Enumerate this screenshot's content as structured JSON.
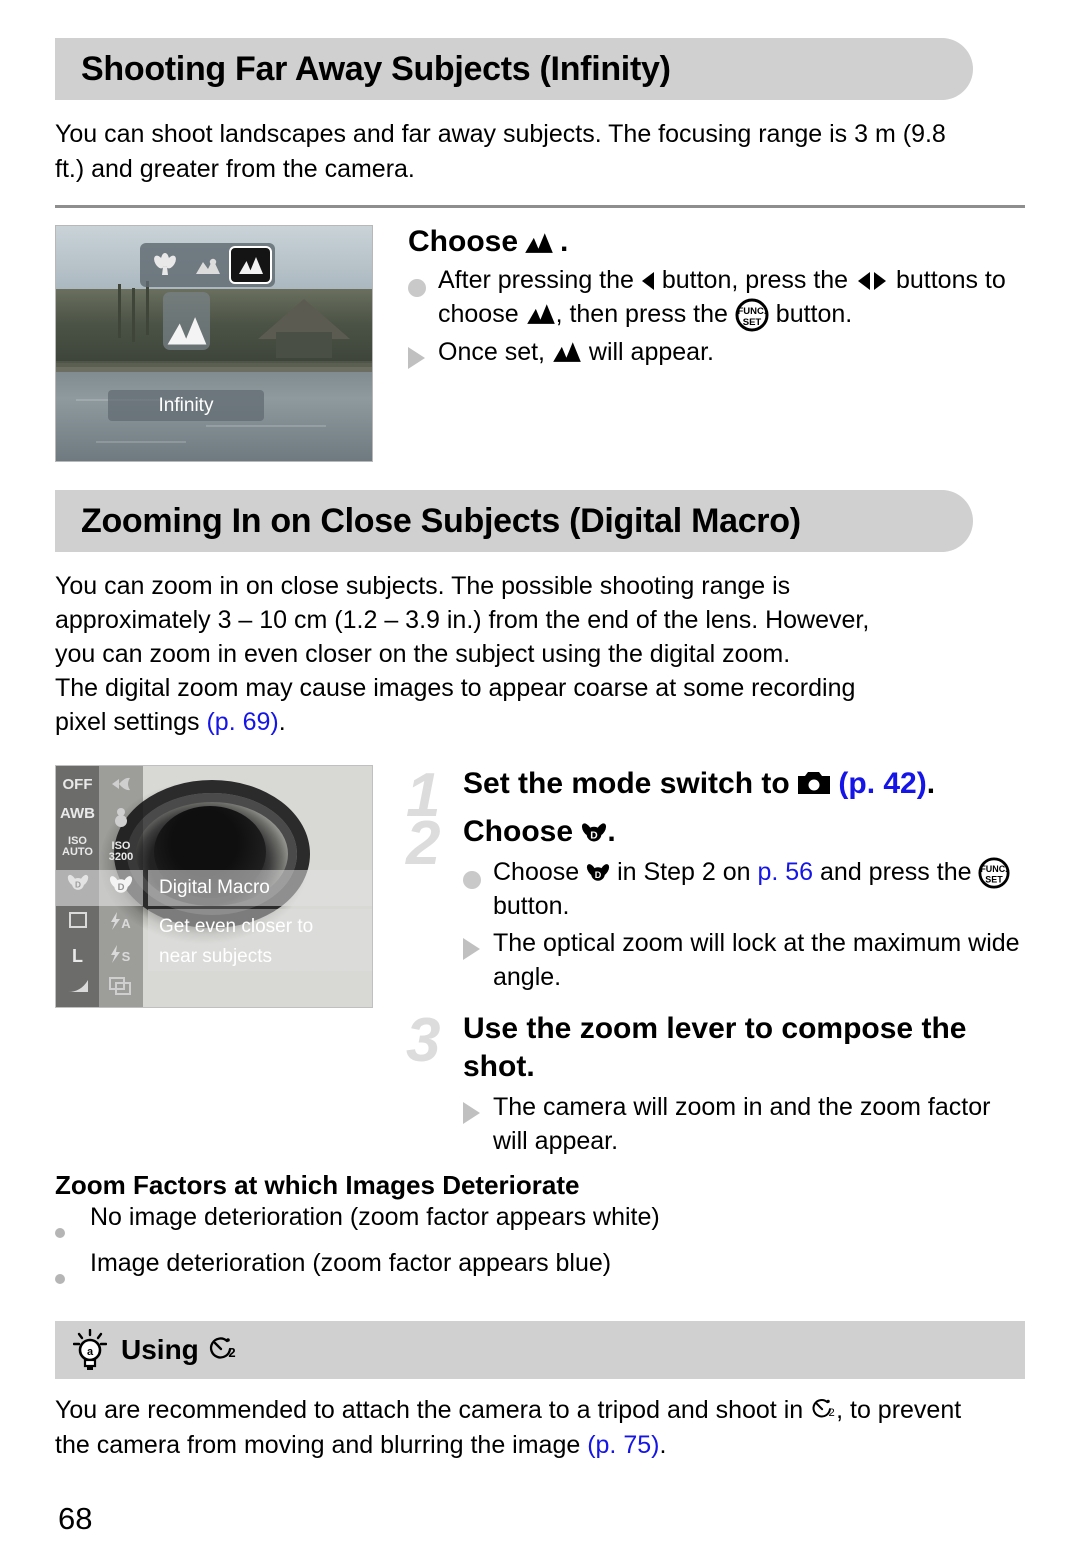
{
  "page": {
    "number": "68",
    "link_color": "#1515e8",
    "banner_color": "#d0d0d0"
  },
  "section1": {
    "title": "Shooting Far Away Subjects (Infinity)",
    "intro": "You can shoot landscapes and far away subjects. The focusing range is 3 m (9.8 ft.) and greater from the camera.",
    "screen": {
      "mode_icons": [
        "macro-flower-icon",
        "macro-mountain-icon",
        "infinity-mountain-icon"
      ],
      "selected_index": 2,
      "label": "Infinity"
    },
    "step": {
      "title_prefix": "Choose",
      "title_icon": "infinity-mountain-icon",
      "title_suffix": ".",
      "bullets": [
        {
          "marker": "dot",
          "parts": [
            {
              "t": "text",
              "v": "After pressing the "
            },
            {
              "t": "icon",
              "v": "left-arrow-button-icon"
            },
            {
              "t": "text",
              "v": " button, press the "
            },
            {
              "t": "icon",
              "v": "left-right-arrow-buttons-icon"
            },
            {
              "t": "text",
              "v": " buttons to choose "
            },
            {
              "t": "icon",
              "v": "infinity-mountain-icon"
            },
            {
              "t": "text",
              "v": ", then press the "
            },
            {
              "t": "icon",
              "v": "func-set-button-icon"
            },
            {
              "t": "text",
              "v": " button."
            }
          ]
        },
        {
          "marker": "triangle",
          "parts": [
            {
              "t": "text",
              "v": "Once set, "
            },
            {
              "t": "icon",
              "v": "infinity-mountain-icon"
            },
            {
              "t": "text",
              "v": " will appear."
            }
          ]
        }
      ]
    }
  },
  "section2": {
    "title": "Zooming In on Close Subjects (Digital Macro)",
    "intro_lines": [
      "You can zoom in on close subjects. The possible shooting range is",
      "approximately 3 – 10 cm (1.2 – 3.9 in.) from the end of the lens. However,",
      "you can zoom in even closer on the subject using the digital zoom.",
      "The digital zoom may cause images to appear coarse at some recording"
    ],
    "intro_last_prefix": "pixel settings ",
    "intro_last_link": "(p. 69)",
    "intro_last_suffix": ".",
    "screen": {
      "left_column_icons": [
        "flash-off-icon",
        "awb-icon",
        "iso-auto-icon",
        "digital-macro-icon",
        "single-shot-icon",
        "large-size-icon",
        "compression-icon"
      ],
      "mid_column_icons": [
        "fish-icon",
        "snow-icon",
        "iso-3200-icon",
        "digital-macro-icon",
        "flash-auto-icon",
        "flash-slow-sync-icon",
        "continuous-shooting-icon"
      ],
      "selected_label": "Digital Macro",
      "description_lines": [
        "Get even closer to",
        "near subjects"
      ]
    },
    "steps": [
      {
        "num": "1",
        "title_parts": [
          {
            "t": "text",
            "v": "Set the mode switch to "
          },
          {
            "t": "icon",
            "v": "camera-mode-icon"
          },
          {
            "t": "text",
            "v": " "
          },
          {
            "t": "link",
            "v": "(p. 42)"
          },
          {
            "t": "text",
            "v": "."
          }
        ],
        "bullets": []
      },
      {
        "num": "2",
        "title_parts": [
          {
            "t": "text",
            "v": "Choose "
          },
          {
            "t": "icon",
            "v": "digital-macro-icon"
          },
          {
            "t": "text",
            "v": "."
          }
        ],
        "bullets": [
          {
            "marker": "dot",
            "parts": [
              {
                "t": "text",
                "v": "Choose "
              },
              {
                "t": "icon",
                "v": "digital-macro-icon"
              },
              {
                "t": "text",
                "v": " in Step 2 on "
              },
              {
                "t": "link",
                "v": "p. 56"
              },
              {
                "t": "text",
                "v": " and press the "
              },
              {
                "t": "icon",
                "v": "func-set-button-icon"
              },
              {
                "t": "text",
                "v": " button."
              }
            ]
          },
          {
            "marker": "triangle",
            "parts": [
              {
                "t": "text",
                "v": "The optical zoom will lock at the maximum wide angle."
              }
            ]
          }
        ]
      },
      {
        "num": "3",
        "title_parts": [
          {
            "t": "text",
            "v": "Use the zoom lever to compose the shot."
          }
        ],
        "bullets": [
          {
            "marker": "triangle",
            "parts": [
              {
                "t": "text",
                "v": "The camera will zoom in and the zoom factor will appear."
              }
            ]
          }
        ]
      }
    ],
    "deterioration": {
      "heading": "Zoom Factors at which Images Deteriorate",
      "items": [
        "No image deterioration (zoom factor appears white)",
        "Image deterioration (zoom factor appears blue)"
      ]
    }
  },
  "tip": {
    "icon": "lightbulb-tip-icon",
    "title": "Using",
    "title_icon": "self-timer-2sec-icon",
    "body_parts": [
      {
        "t": "text",
        "v": "You are recommended to attach the camera to a tripod and shoot in "
      },
      {
        "t": "icon",
        "v": "self-timer-2sec-icon"
      },
      {
        "t": "text",
        "v": ", to prevent the camera from moving and blurring the image "
      },
      {
        "t": "link",
        "v": "(p. 75)"
      },
      {
        "t": "text",
        "v": "."
      }
    ]
  }
}
